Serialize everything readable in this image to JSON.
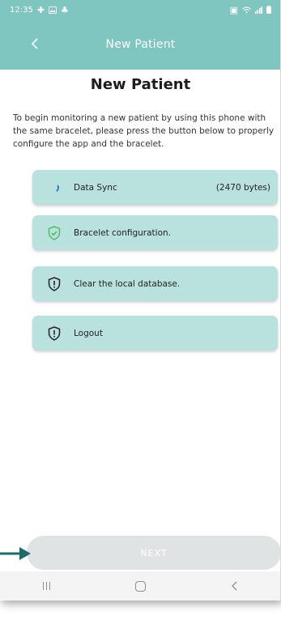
{
  "status_bar": {
    "time": "12:35"
  },
  "header": {
    "title": "New Patient"
  },
  "page": {
    "title": "New Patient",
    "intro": "To begin monitoring a new patient by using this phone with the same bracelet, please press the button below to properly configure the app and the bracelet."
  },
  "actions": [
    {
      "label": "Data Sync",
      "extra": "(2470 bytes)",
      "icon": "sync-spinner-icon"
    },
    {
      "label": "Bracelet configuration.",
      "icon": "shield-check-icon"
    },
    {
      "label": "Clear the local database.",
      "icon": "shield-alert-icon"
    },
    {
      "label": "Logout",
      "icon": "shield-alert-icon"
    }
  ],
  "next_button": {
    "label": "NEXT"
  },
  "colors": {
    "header": "#7fc5c0",
    "card": "#b9e1dd",
    "check": "#4fbf66",
    "spinner": "#2f7fbf",
    "arrow": "#1e6b6b"
  }
}
